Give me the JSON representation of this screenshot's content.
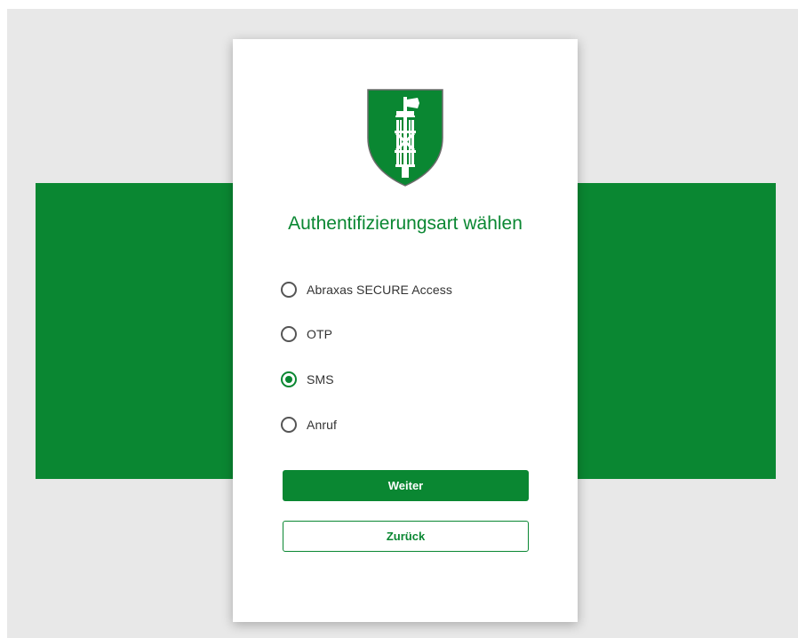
{
  "colors": {
    "accent": "#0a8732",
    "backdrop": "#e8e8e8",
    "band": "#0a8732",
    "radio_border": "#555555",
    "text": "#333333"
  },
  "crest": {
    "icon": "st-gallen-crest-icon"
  },
  "heading": "Authentifizierungsart wählen",
  "options": [
    {
      "label": "Abraxas SECURE Access",
      "checked": false
    },
    {
      "label": "OTP",
      "checked": false
    },
    {
      "label": "SMS",
      "checked": true
    },
    {
      "label": "Anruf",
      "checked": false
    }
  ],
  "buttons": {
    "primary_label": "Weiter",
    "secondary_label": "Zurück"
  }
}
